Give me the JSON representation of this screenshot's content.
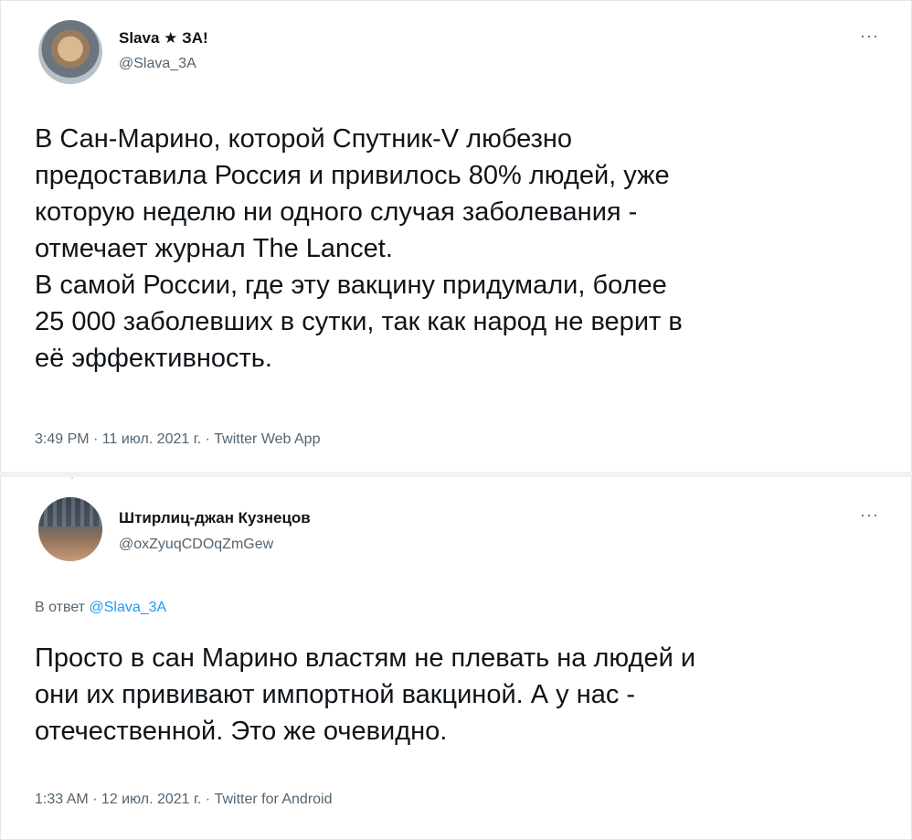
{
  "tweets": [
    {
      "author_name": "Slava ★ ЗА!",
      "handle": "@Slava_3A",
      "more_icon": "more-dots-icon",
      "text_lines": [
        "В Сан-Марино, которой Спутник-V любезно",
        "предоставила Россия и привилось 80% людей, уже",
        "которую неделю ни одного случая заболевания -",
        "отмечает журнал The Lancet.",
        "В самой России, где эту вакцину придумали, более",
        "25 000 заболевших в сутки, так как народ не верит в",
        "её эффективность."
      ],
      "meta": "3:49 PM · 11 июл. 2021 г. · Twitter Web App"
    },
    {
      "author_name": "Штирлиц-джан Кузнецов",
      "handle": "@oxZyuqCDOqZmGew",
      "more_icon": "more-dots-icon",
      "reply_prefix": "В ответ",
      "reply_handle": "@Slava_3A",
      "text_lines": [
        "Просто в сан Марино властям не плевать на людей и",
        "они их прививают импортной вакциной. А у нас -",
        "отечественной. Это же очевидно."
      ],
      "meta": "1:33 AM · 12 июл. 2021 г. · Twitter for Android"
    }
  ],
  "more_symbol": "···",
  "colors": {
    "text": "#0f1419",
    "secondary": "#536471",
    "link": "#1d9bf0",
    "separator": "#f2f2f2"
  }
}
